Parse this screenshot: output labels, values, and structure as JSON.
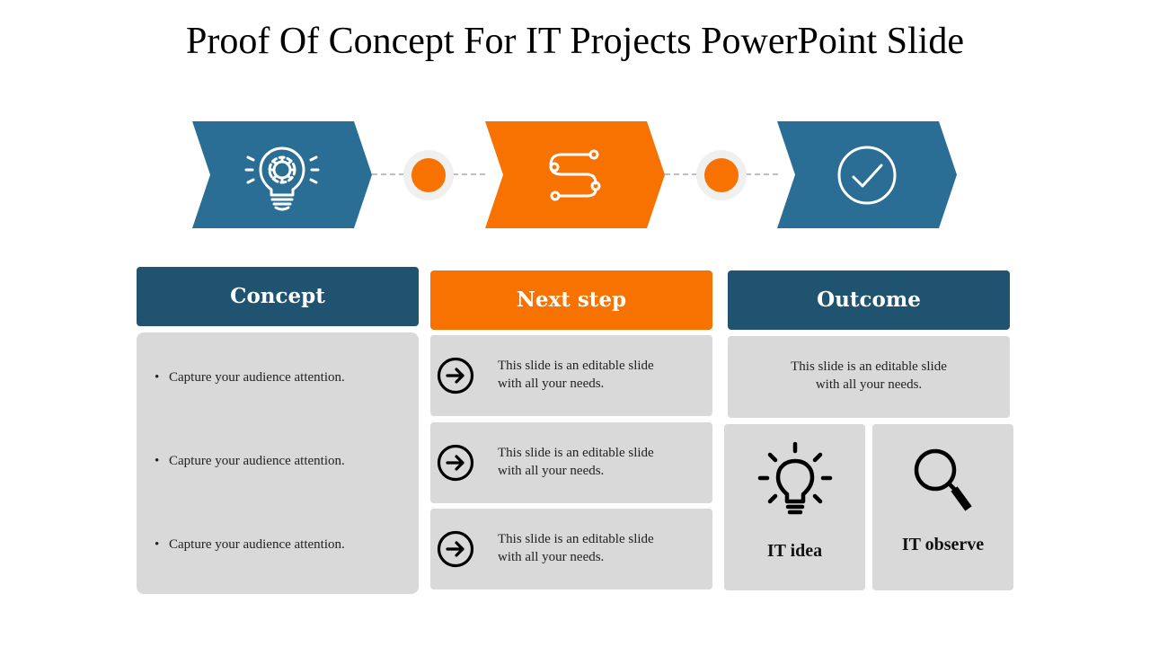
{
  "title": "Proof Of Concept For IT Projects PowerPoint Slide",
  "colors": {
    "blue": "#2a6d95",
    "dark_blue": "#1f5370",
    "orange": "#f77200",
    "panel_gray": "#d9d9d9",
    "dot_ring": "#f0f0f0",
    "connector": "#bfbfbf"
  },
  "process": [
    {
      "step": "concept",
      "icon": "lightbulb-gear-icon",
      "color": "blue"
    },
    {
      "step": "next-step",
      "icon": "route-path-icon",
      "color": "orange"
    },
    {
      "step": "outcome",
      "icon": "check-circle-icon",
      "color": "blue"
    }
  ],
  "columns": {
    "concept": {
      "header": "Concept",
      "bullets": [
        "Capture your audience attention.",
        "Capture your audience attention.",
        "Capture your audience attention."
      ]
    },
    "next_step": {
      "header": "Next step",
      "rows": [
        {
          "icon": "arrow-right-circle-icon",
          "line1": "This slide is an editable slide",
          "line2": "with all your needs."
        },
        {
          "icon": "arrow-right-circle-icon",
          "line1": "This slide is an editable slide",
          "line2": "with all your needs."
        },
        {
          "icon": "arrow-right-circle-icon",
          "line1": "This slide is an editable slide",
          "line2": "with all your needs."
        }
      ]
    },
    "outcome": {
      "header": "Outcome",
      "line1": "This slide is an editable slide",
      "line2": "with all your needs.",
      "tiles": [
        {
          "icon": "lightbulb-icon",
          "label": "IT idea"
        },
        {
          "icon": "magnifier-icon",
          "label": "IT observe"
        }
      ]
    }
  }
}
